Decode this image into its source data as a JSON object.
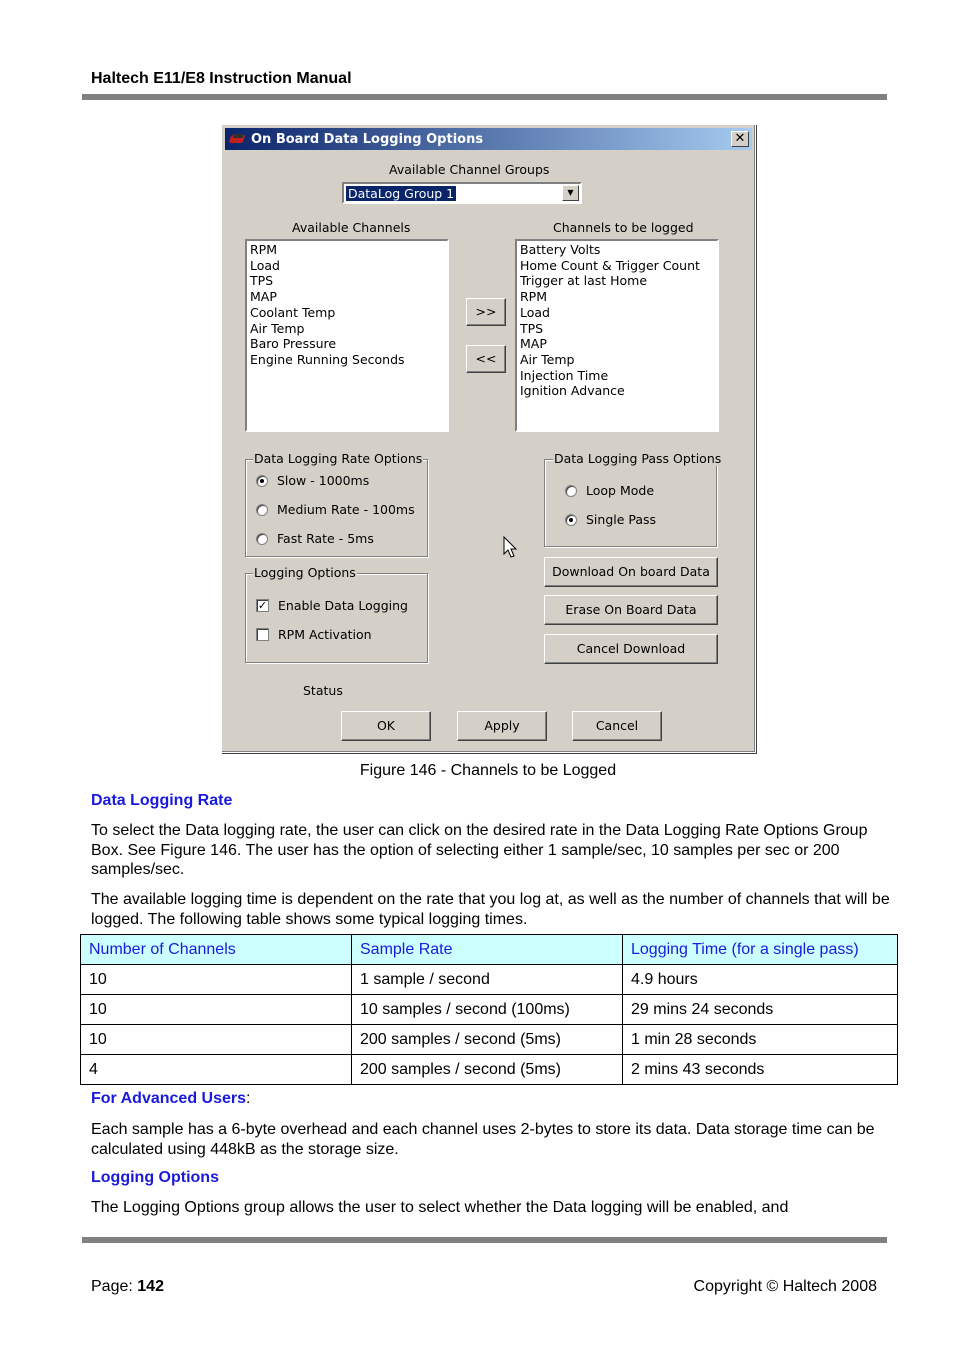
{
  "header": {
    "title": "Haltech E11/E8 Instruction Manual"
  },
  "dialog": {
    "title": "On Board Data Logging Options",
    "close_glyph": "✕",
    "channel_groups_label": "Available Channel Groups",
    "channel_group_selected": "DataLog Group 1",
    "dropdown_glyph": "▼",
    "available_label": "Available Channels",
    "logged_label": "Channels to be logged",
    "available_channels": [
      "RPM",
      "Load",
      "TPS",
      "MAP",
      "Coolant Temp",
      "Air Temp",
      "Baro Pressure",
      "Engine Running Seconds"
    ],
    "logged_channels": [
      "Battery Volts",
      "Home Count & Trigger Count",
      "Trigger at last Home",
      "RPM",
      "Load",
      "TPS",
      "MAP",
      "Air Temp",
      "Injection Time",
      "Ignition Advance"
    ],
    "add_button": ">>",
    "remove_button": "<<",
    "rate_group": {
      "title": "Data Logging Rate Options",
      "options": [
        {
          "label": "Slow - 1000ms",
          "selected": true
        },
        {
          "label": "Medium Rate - 100ms",
          "selected": false
        },
        {
          "label": "Fast Rate - 5ms",
          "selected": false
        }
      ]
    },
    "pass_group": {
      "title": "Data Logging Pass Options",
      "options": [
        {
          "label": "Loop Mode",
          "selected": false
        },
        {
          "label": "Single Pass",
          "selected": true
        }
      ]
    },
    "logging_group": {
      "title": "Logging Options",
      "options": [
        {
          "label": "Enable Data Logging",
          "checked": true,
          "mark": "✓"
        },
        {
          "label": "RPM Activation",
          "checked": false,
          "mark": ""
        }
      ]
    },
    "action_buttons": {
      "download": "Download On board Data",
      "erase": "Erase On Board Data",
      "cancel_download": "Cancel Download"
    },
    "status_label": "Status",
    "footer_buttons": {
      "ok": "OK",
      "apply": "Apply",
      "cancel": "Cancel"
    }
  },
  "caption": "Figure 146 - Channels to be Logged",
  "sections": {
    "rate_heading": "Data Logging Rate",
    "rate_para1": "To select the Data logging rate, the user can click on the desired rate in the Data Logging Rate Options Group Box. See Figure 146. The user has the option of selecting either 1 sample/sec, 10 samples per sec or 200 samples/sec.",
    "rate_para2": "The available logging time is dependent on the rate that you log at, as well as the number of channels that will be logged. The following table shows some typical logging times.",
    "advanced_heading": "For Advanced Users",
    "advanced_colon": ":",
    "advanced_para": "Each sample has a 6-byte overhead and each channel uses 2-bytes to store its data. Data storage time can be calculated using 448kB as the storage size.",
    "logging_heading": "Logging Options",
    "logging_para": "The Logging Options group allows the user to select whether the Data logging will be enabled, and"
  },
  "table": {
    "headers": [
      "Number of Channels",
      "Sample Rate",
      "Logging Time (for a single pass)"
    ],
    "rows": [
      [
        "10",
        "1 sample / second",
        "4.9 hours"
      ],
      [
        "10",
        "10 samples / second (100ms)",
        "29 mins 24 seconds"
      ],
      [
        "10",
        "200 samples / second (5ms)",
        "1 min 28 seconds"
      ],
      [
        "4",
        "200 samples / second (5ms)",
        "2 mins 43 seconds"
      ]
    ]
  },
  "footer": {
    "page_label": "Page: ",
    "page_number": "142",
    "copyright": "Copyright © Haltech 2008"
  }
}
